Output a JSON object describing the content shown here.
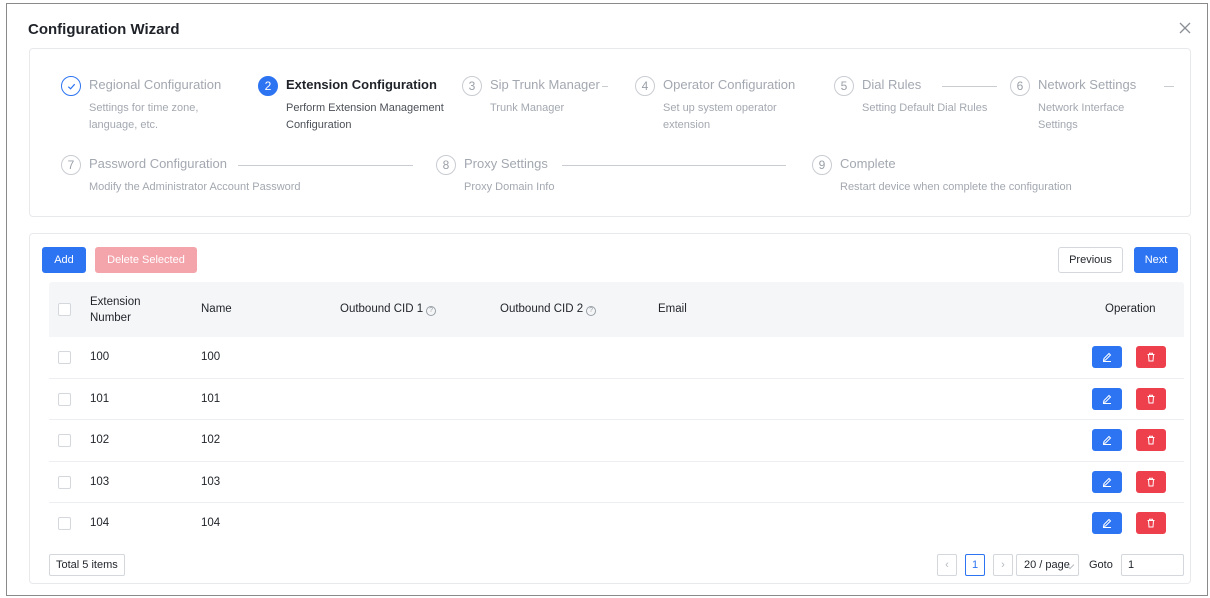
{
  "modal": {
    "title": "Configuration Wizard"
  },
  "steps": [
    {
      "num": "1",
      "title": "Regional Configuration",
      "desc": "Settings for time zone, language, etc.",
      "state": "done"
    },
    {
      "num": "2",
      "title": "Extension Configuration",
      "desc": "Perform Extension Management Configuration",
      "state": "active"
    },
    {
      "num": "3",
      "title": "Sip Trunk Manager",
      "desc": "Trunk Manager",
      "state": "pending"
    },
    {
      "num": "4",
      "title": "Operator Configuration",
      "desc": "Set up system operator extension",
      "state": "pending"
    },
    {
      "num": "5",
      "title": "Dial Rules",
      "desc": "Setting Default Dial Rules",
      "state": "pending"
    },
    {
      "num": "6",
      "title": "Network Settings",
      "desc": "Network Interface Settings",
      "state": "pending"
    },
    {
      "num": "7",
      "title": "Password Configuration",
      "desc": "Modify the Administrator Account Password",
      "state": "pending"
    },
    {
      "num": "8",
      "title": "Proxy Settings",
      "desc": "Proxy Domain Info",
      "state": "pending"
    },
    {
      "num": "9",
      "title": "Complete",
      "desc": "Restart device when complete the configuration",
      "state": "pending"
    }
  ],
  "toolbar": {
    "add_label": "Add",
    "delete_label": "Delete Selected",
    "previous_label": "Previous",
    "next_label": "Next"
  },
  "table": {
    "headers": {
      "extension_line1": "Extension",
      "extension_line2": "Number",
      "name": "Name",
      "cid1": "Outbound CID 1",
      "cid2": "Outbound CID 2",
      "email": "Email",
      "operation": "Operation"
    },
    "rows": [
      {
        "extension": "100",
        "name": "100",
        "cid1": "",
        "cid2": "",
        "email": ""
      },
      {
        "extension": "101",
        "name": "101",
        "cid1": "",
        "cid2": "",
        "email": ""
      },
      {
        "extension": "102",
        "name": "102",
        "cid1": "",
        "cid2": "",
        "email": ""
      },
      {
        "extension": "103",
        "name": "103",
        "cid1": "",
        "cid2": "",
        "email": ""
      },
      {
        "extension": "104",
        "name": "104",
        "cid1": "",
        "cid2": "",
        "email": ""
      }
    ]
  },
  "pagination": {
    "total_label": "Total 5 items",
    "prev_symbol": "‹",
    "current_page": "1",
    "next_symbol": "›",
    "page_size": "20 / page",
    "goto_label": "Goto",
    "goto_value": "1"
  },
  "icons": {
    "close": "close-icon",
    "check": "check-icon",
    "help": "help-circle-icon",
    "edit": "pencil-icon",
    "delete": "trash-icon"
  },
  "colors": {
    "primary": "#2d74f2",
    "danger": "#ee3f4d",
    "danger_disabled": "#f4a4ab",
    "muted_text": "#a3a8b0"
  }
}
